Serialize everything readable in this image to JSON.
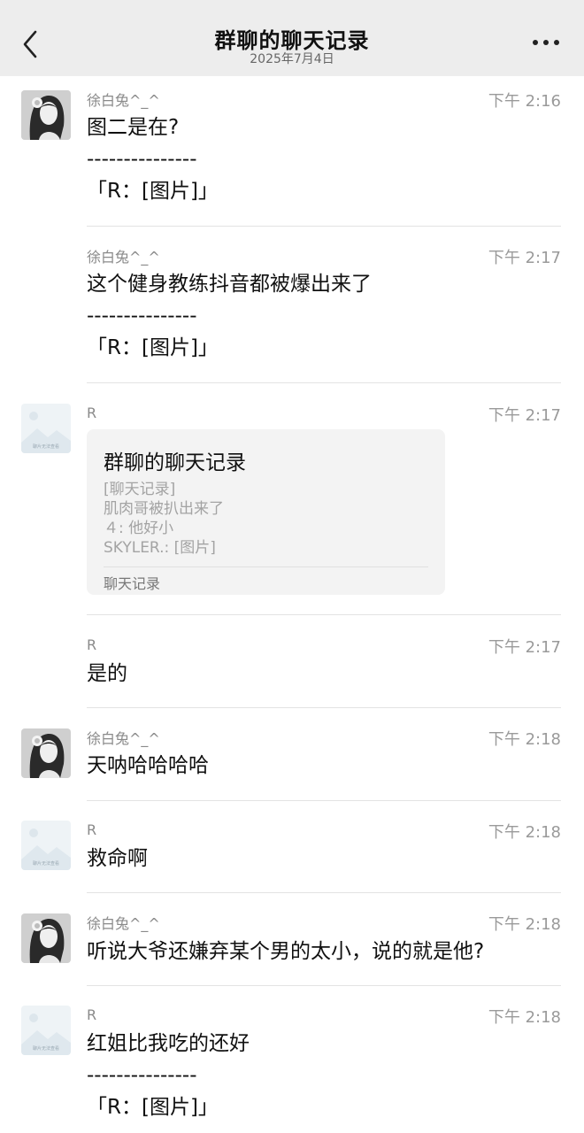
{
  "header": {
    "title": "群聊的聊天记录",
    "date": "2025年7月4日"
  },
  "messages": [
    {
      "sender": "徐白兔^_^",
      "time": "下午 2:16",
      "lines": [
        "图二是在?",
        "---------------",
        "「R：[图片]」"
      ]
    },
    {
      "sender": "徐白兔^_^",
      "time": "下午 2:17",
      "lines": [
        "这个健身教练抖音都被爆出来了",
        "---------------",
        "「R：[图片]」"
      ]
    },
    {
      "sender": "R",
      "time": "下午 2:17",
      "card": {
        "title": "群聊的聊天记录",
        "lines": [
          "[聊天记录]",
          "肌肉哥被扒出来了",
          "４: 他好小",
          "SKYLER.: [图片]"
        ],
        "footer": "聊天记录"
      }
    },
    {
      "sender": "R",
      "time": "下午 2:17",
      "lines": [
        "是的"
      ]
    },
    {
      "sender": "徐白兔^_^",
      "time": "下午 2:18",
      "lines": [
        "天呐哈哈哈哈"
      ]
    },
    {
      "sender": "R",
      "time": "下午 2:18",
      "lines": [
        "救命啊"
      ]
    },
    {
      "sender": "徐白兔^_^",
      "time": "下午 2:18",
      "lines": [
        "听说大爷还嫌弃某个男的太小，说的就是他?"
      ]
    },
    {
      "sender": "R",
      "time": "下午 2:18",
      "lines": [
        "红姐比我吃的还好",
        "---------------",
        "「R：[图片]」"
      ]
    }
  ],
  "avatar_placeholder_text": "聊片无法查看",
  "icons": {
    "back": "chevron-left-icon",
    "more": "more-dots-icon"
  }
}
